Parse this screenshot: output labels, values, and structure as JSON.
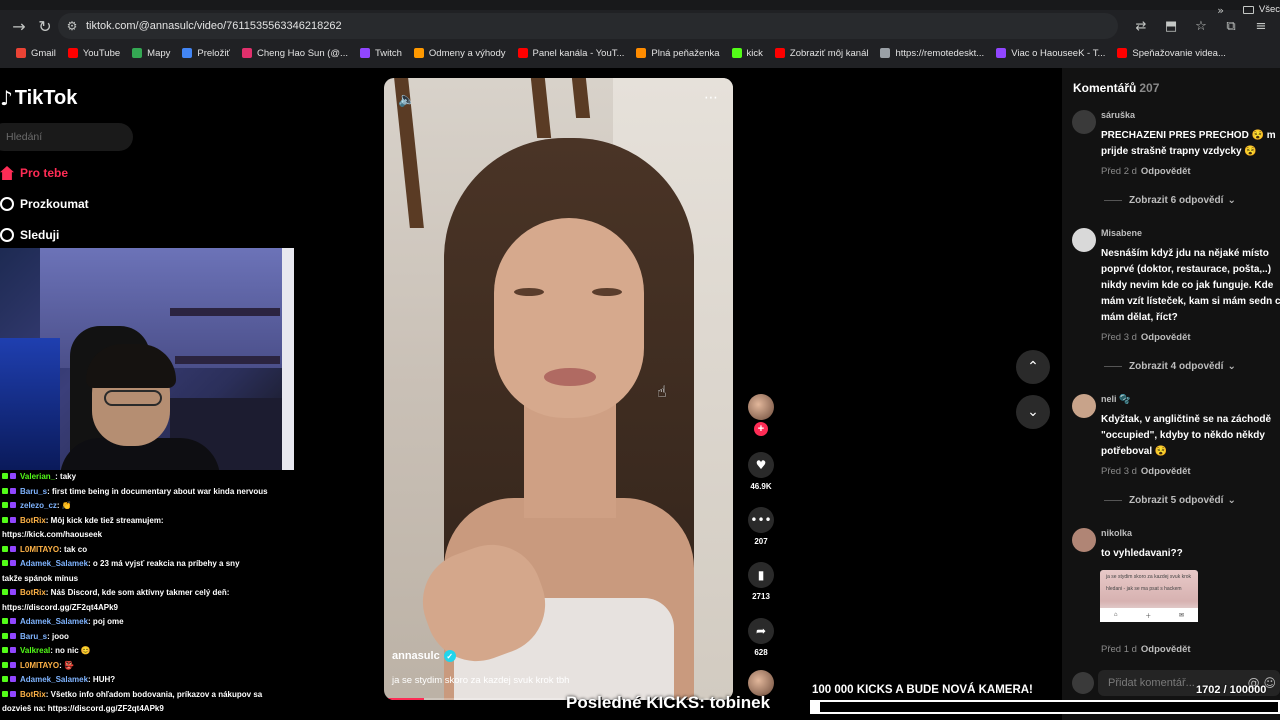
{
  "browser": {
    "url": "tiktok.com/@annasulc/video/7611535563346218262",
    "bookmarks": [
      {
        "label": "Gmail",
        "color": "#ea4335"
      },
      {
        "label": "YouTube",
        "color": "#ff0000"
      },
      {
        "label": "Mapy",
        "color": "#34a853"
      },
      {
        "label": "Preložiť",
        "color": "#4285f4"
      },
      {
        "label": "Cheng Hao Sun (@...",
        "color": "#e1306c"
      },
      {
        "label": "Twitch",
        "color": "#9146ff"
      },
      {
        "label": "Odmeny a výhody",
        "color": "#ff9900"
      },
      {
        "label": "Panel kanála - YouT...",
        "color": "#ff0000"
      },
      {
        "label": "Plná peňaženka",
        "color": "#ff8c00"
      },
      {
        "label": "kick",
        "color": "#53fc18"
      },
      {
        "label": "Zobraziť môj kanál",
        "color": "#ff0000"
      },
      {
        "label": "https://remotedeskt...",
        "color": "#9aa0a6"
      },
      {
        "label": "Viac o HaouseeK - T...",
        "color": "#9146ff"
      },
      {
        "label": "Speňažovanie videa...",
        "color": "#ff0000"
      }
    ],
    "all_bookmarks": "Všec"
  },
  "tiktok": {
    "logo": "TikTok",
    "search_placeholder": "Hledání",
    "nav": {
      "for_you": "Pro tebe",
      "explore": "Prozkoumat",
      "following": "Sleduji"
    }
  },
  "video": {
    "author": "annasulc",
    "caption": "ja se stydim skoro za kazdej svuk krok tbh",
    "likes": "46.9K",
    "comments": "207",
    "saves": "2713",
    "shares": "628"
  },
  "comments": {
    "title": "Komentářů",
    "count": "207",
    "items": [
      {
        "user": "sáruška",
        "text": "PRECHAZENI PRES PRECHOD 😵 m prijde strašně trapny vzdycky 😵",
        "time": "Před 2 d",
        "reply": "Odpovědět",
        "more": "Zobrazit 6 odpovědí",
        "avatar": "#3a3a3a"
      },
      {
        "user": "Misabene",
        "text": "Nesnáším když jdu na nějaké místo poprvé (doktor, restaurace, pošta,..) nikdy nevim kde co jak funguje. Kde mám vzít lísteček, kam si mám sedn co mám dělat, říct?",
        "time": "Před 3 d",
        "reply": "Odpovědět",
        "more": "Zobrazit 4 odpovědí",
        "avatar": "#d9d9d9"
      },
      {
        "user": "neli 🫧",
        "text": "Kdyžtak, v angličtině se na záchodě \"occupied\", kdyby to někdo někdy potřeboval 😵",
        "time": "Před 3 d",
        "reply": "Odpovědět",
        "more": "Zobrazit 5 odpovědí",
        "avatar": "#c8a38a"
      },
      {
        "user": "nikolka",
        "text": "to vyhledavani??",
        "time": "Před 1 d",
        "reply": "Odpovědět",
        "avatar": "#b08575"
      }
    ],
    "input_placeholder": "Přidat komentář...",
    "thumb_lines": [
      "ja se stydim skoro za kazdej svuk krok",
      "hledani - jak se ma psat s hackem"
    ]
  },
  "stream": {
    "chat": [
      {
        "user": "Valerian_",
        "msg": ": taky",
        "ucolor": "green"
      },
      {
        "user": "Baru_s",
        "msg": ": first time being in documentary about war kinda nervous",
        "ucolor": "blue"
      },
      {
        "user": "zelezo_cz",
        "msg": ": 👏",
        "ucolor": "blue"
      },
      {
        "user": "BotRix",
        "msg": ": Môj kick kde tiež streamujem:",
        "ucolor": "orange"
      },
      {
        "user": "",
        "msg": "https://kick.com/haouseek",
        "ucolor": "blue"
      },
      {
        "user": "L0MITAYO",
        "msg": ": tak co",
        "ucolor": "orange"
      },
      {
        "user": "Adamek_Salamek",
        "msg": ": o 23 má vyjsť reakcia na príbehy a sny",
        "ucolor": "blue"
      },
      {
        "user": "",
        "msg": "takže spánok mínus",
        "ucolor": "blue"
      },
      {
        "user": "BotRix",
        "msg": ": Náš Discord, kde som aktívny takmer celý deň:",
        "ucolor": "orange"
      },
      {
        "user": "",
        "msg": "https://discord.gg/ZF2qt4APk9",
        "ucolor": "blue"
      },
      {
        "user": "Adamek_Salamek",
        "msg": ": poj ome",
        "ucolor": "blue"
      },
      {
        "user": "Baru_s",
        "msg": ": jooo",
        "ucolor": "blue"
      },
      {
        "user": "Valkreal",
        "msg": ": no nic 😊",
        "ucolor": "green"
      },
      {
        "user": "L0MITAYO",
        "msg": ": 👺",
        "ucolor": "orange"
      },
      {
        "user": "Adamek_Salamek",
        "msg": ": HUH?",
        "ucolor": "blue"
      },
      {
        "user": "BotRix",
        "msg": ": Všetko info ohľadom bodovania, príkazov a nákupov sa",
        "ucolor": "orange"
      },
      {
        "user": "",
        "msg": "dozvieš na: https://discord.gg/ZF2qt4APk9",
        "ucolor": "blue"
      }
    ],
    "last_kicks": "Posledné KICKS: tobinek",
    "goal_title": "100 000 KICKS A BUDE NOVÁ KAMERA!",
    "goal_count": "1702 / 100000",
    "goal_progress": 0.017
  },
  "colors": {
    "tiktok_red": "#fe2c55",
    "verified": "#20d5ec"
  }
}
